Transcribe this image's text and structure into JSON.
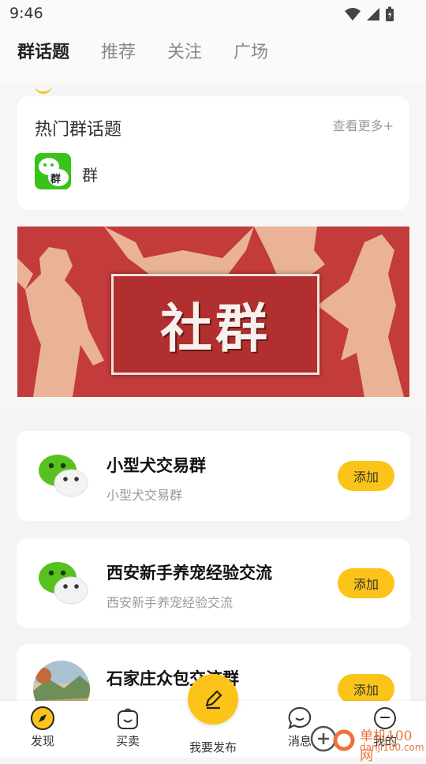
{
  "status": {
    "time": "9:46"
  },
  "tabs": [
    {
      "label": "群话题",
      "active": true
    },
    {
      "label": "推荐"
    },
    {
      "label": "关注"
    },
    {
      "label": "广场"
    }
  ],
  "hot_topics": {
    "title": "热门群话题",
    "more": "查看更多+",
    "items": [
      {
        "label": "群",
        "badge": "群"
      }
    ]
  },
  "banner": {
    "text": "社群"
  },
  "groups": [
    {
      "name": "小型犬交易群",
      "desc": "小型犬交易群",
      "action": "添加",
      "icon": "wechat-icon"
    },
    {
      "name": "西安新手养宠经验交流",
      "desc": "西安新手养宠经验交流",
      "action": "添加",
      "icon": "wechat-icon"
    },
    {
      "name": "石家庄众包交流群",
      "desc": "",
      "action": "添加",
      "icon": "landscape-avatar"
    }
  ],
  "bottom_nav": [
    {
      "label": "发现",
      "icon": "compass-icon"
    },
    {
      "label": "买卖",
      "icon": "bag-icon"
    },
    {
      "label": "我要发布",
      "icon": "pen-icon"
    },
    {
      "label": "消息",
      "icon": "chat-icon"
    },
    {
      "label": "我的",
      "icon": "user-icon"
    }
  ],
  "watermark": {
    "text": "单机100网",
    "sub": "danji100.com"
  },
  "colors": {
    "accent": "#fcc418",
    "banner": "#c33b3b",
    "wechat_green": "#39c21a"
  }
}
